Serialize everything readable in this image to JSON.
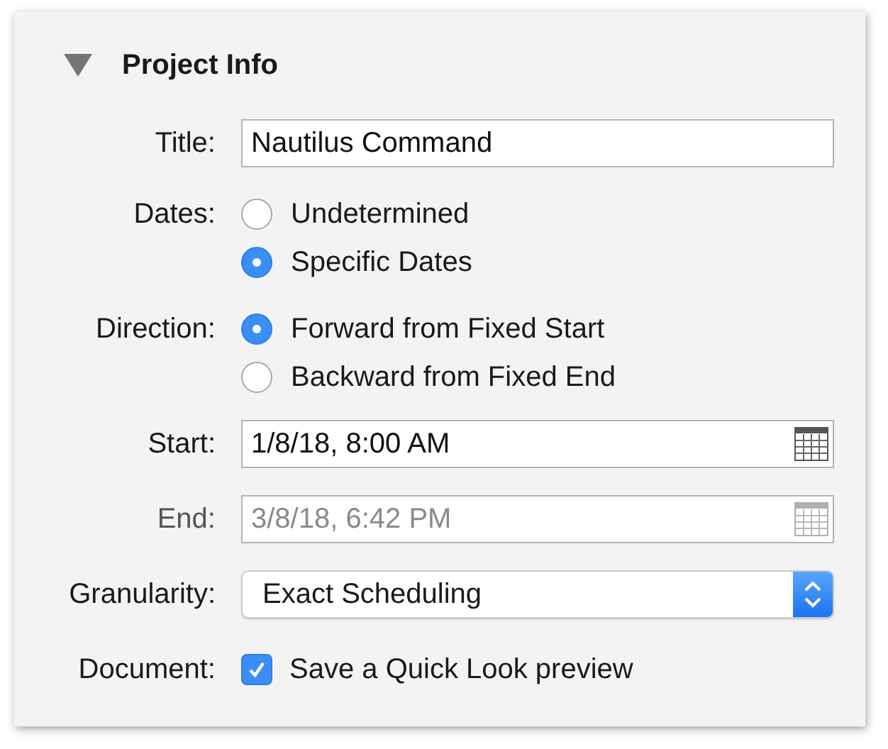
{
  "section": {
    "title": "Project Info",
    "expanded": true
  },
  "fields": [
    {
      "kind": "text",
      "label": "Title:",
      "value": "Nautilus Command"
    },
    {
      "kind": "radio",
      "label": "Dates:",
      "options": [
        {
          "label": "Undetermined",
          "selected": false
        },
        {
          "label": "Specific Dates",
          "selected": true
        }
      ]
    },
    {
      "kind": "radio",
      "label": "Direction:",
      "options": [
        {
          "label": "Forward from Fixed Start",
          "selected": true
        },
        {
          "label": "Backward from Fixed End",
          "selected": false
        }
      ]
    },
    {
      "kind": "date",
      "label": "Start:",
      "value": "1/8/18, 8:00 AM",
      "disabled": false
    },
    {
      "kind": "date",
      "label": "End:",
      "value": "3/8/18, 6:42 PM",
      "disabled": true
    },
    {
      "kind": "popup",
      "label": "Granularity:",
      "value": "Exact Scheduling"
    },
    {
      "kind": "checkbox",
      "label": "Document:",
      "text": "Save a Quick Look preview",
      "checked": true
    }
  ]
}
